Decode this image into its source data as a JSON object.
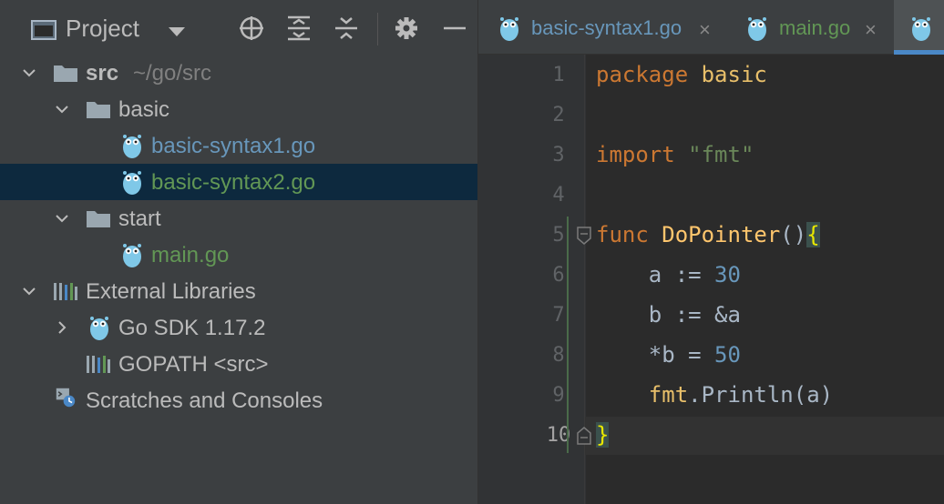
{
  "project_panel": {
    "title": "Project",
    "toolbar": {
      "locate_icon": "crosshair-icon",
      "expand_icon": "expand-all-icon",
      "collapse_icon": "collapse-all-icon",
      "settings_icon": "gear-icon",
      "hide_icon": "minus-icon"
    },
    "tree": [
      {
        "label": "src",
        "suffix": "~/go/src",
        "type": "folder",
        "expanded": true
      },
      {
        "label": "basic",
        "type": "folder",
        "expanded": true
      },
      {
        "label": "basic-syntax1.go",
        "type": "go-file",
        "color": "#6897bb"
      },
      {
        "label": "basic-syntax2.go",
        "type": "go-file",
        "color": "#629755",
        "selected": true
      },
      {
        "label": "start",
        "type": "folder",
        "expanded": true
      },
      {
        "label": "main.go",
        "type": "go-file",
        "color": "#629755"
      },
      {
        "label": "External Libraries",
        "type": "library",
        "expanded": true
      },
      {
        "label": "Go SDK 1.17.2",
        "type": "go-sdk",
        "expanded": false
      },
      {
        "label": "GOPATH <src>",
        "type": "library"
      },
      {
        "label": "Scratches and Consoles",
        "type": "scratches"
      }
    ]
  },
  "editor": {
    "tabs": [
      {
        "label": "basic-syntax1.go",
        "color": "#6897bb",
        "close": "×"
      },
      {
        "label": "main.go",
        "color": "#629755",
        "close": "×"
      },
      {
        "label": "",
        "active": true
      }
    ],
    "line_numbers": [
      "1",
      "2",
      "3",
      "4",
      "5",
      "6",
      "7",
      "8",
      "9",
      "10"
    ],
    "current_line": 10,
    "code": {
      "l1_kw": "package",
      "l1_name": "basic",
      "l3_kw": "import",
      "l3_str": "\"fmt\"",
      "l5_kw": "func",
      "l5_fn": "DoPointer",
      "l5_parens": "()",
      "l5_brace": "{",
      "l6_a": "a := ",
      "l6_num": "30",
      "l7": "b := &a",
      "l8_a": "*b = ",
      "l8_num": "50",
      "l9_pkg": "fmt",
      "l9_rest": ".Println(a)",
      "l10_brace": "}"
    }
  },
  "colors": {
    "panel_bg": "#3c3f41",
    "editor_bg": "#2b2b2b",
    "selection": "#0d293e",
    "accent": "#4a88c7"
  }
}
